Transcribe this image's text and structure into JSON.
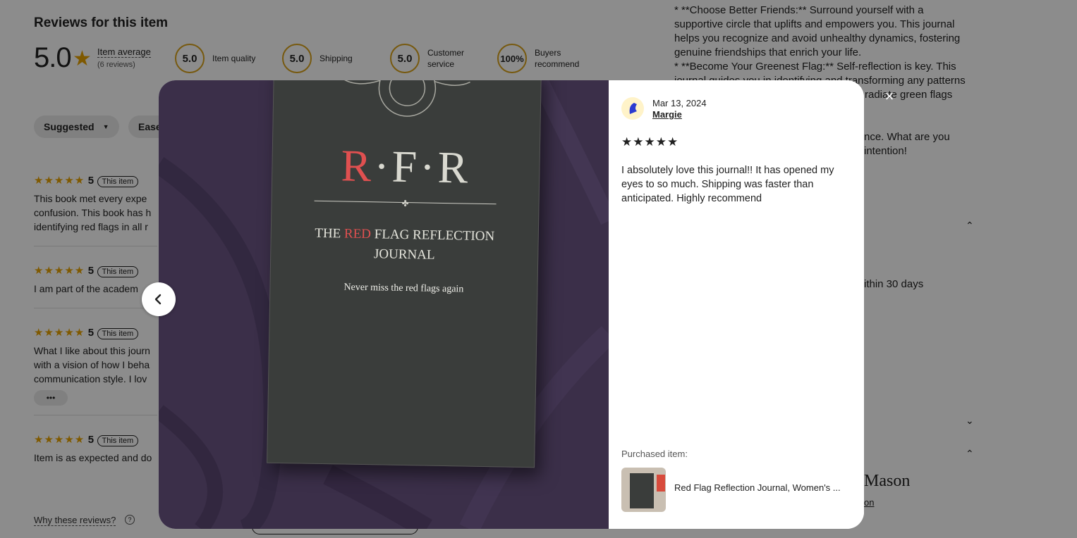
{
  "page": {
    "reviews_heading": "Reviews for this item",
    "average_score": "5.0",
    "average_label": "Item average",
    "review_count": "(6 reviews)",
    "metrics": [
      {
        "value": "5.0",
        "label": "Item quality"
      },
      {
        "value": "5.0",
        "label": "Shipping"
      },
      {
        "value": "5.0",
        "label": "Customer service"
      },
      {
        "value": "100%",
        "label": "Buyers recommend"
      }
    ],
    "filters": {
      "sort_label": "Suggested",
      "second_label": "Ease"
    },
    "reviews": [
      {
        "stars": "★★★★★",
        "rating": "5",
        "badge": "This item",
        "lines": [
          "This book met every expe",
          "confusion. This book has h",
          "identifying red flags in all r"
        ]
      },
      {
        "stars": "★★★★★",
        "rating": "5",
        "badge": "This item",
        "lines": [
          "I am part of the academ"
        ]
      },
      {
        "stars": "★★★★★",
        "rating": "5",
        "badge": "This item",
        "lines": [
          "What I like about this journ",
          "with a vision of how I beha",
          "communication style. I lov"
        ]
      },
      {
        "stars": "★★★★★",
        "rating": "5",
        "badge": "This item",
        "lines": [
          "Item is as expected and do"
        ]
      }
    ],
    "more_button": "•••",
    "why_reviews": "Why these reviews?",
    "description_lines": [
      "* **Choose Better Friends:** Surround yourself with a",
      "supportive circle that uplifts and empowers you. This journal",
      "helps you recognize and avoid unhealthy dynamics, fostering",
      "genuine friendships that enrich your life.",
      "* **Become Your Greenest Flag:** Self-reflection is key. This",
      "journal guides you in identifying and transforming any patterns",
      "radiate green flags"
    ],
    "desc_line_b1": "nce. What are you",
    "desc_line_b2": "intention!",
    "returns_text": "ithin 30 days",
    "shop_name": "Mason",
    "shop_link": "on"
  },
  "modal": {
    "close_icon": "×",
    "date": "Mar 13, 2024",
    "reviewer": "Margie",
    "stars": "★★★★★",
    "review_text": "I absolutely love this journal!! It has opened my eyes to so much. Shipping was faster than anticipated. Highly recommend",
    "purchased_label": "Purchased item:",
    "purchased_title": "Red Flag Reflection Journal, Women's ...",
    "photo": {
      "book_letters": "R·F·R",
      "book_title_1_red": "RED",
      "book_title_1_pre": "THE ",
      "book_title_1_post": " FLAG REFLECTION",
      "book_title_2": "JOURNAL",
      "book_tagline": "Never miss the red flags again"
    }
  },
  "colors": {
    "star": "#e8a200",
    "overlay": "rgba(0,0,0,0.45)",
    "book": "#3a3d3b",
    "blanket": "#3b2f49",
    "title_red": "#e05050"
  }
}
